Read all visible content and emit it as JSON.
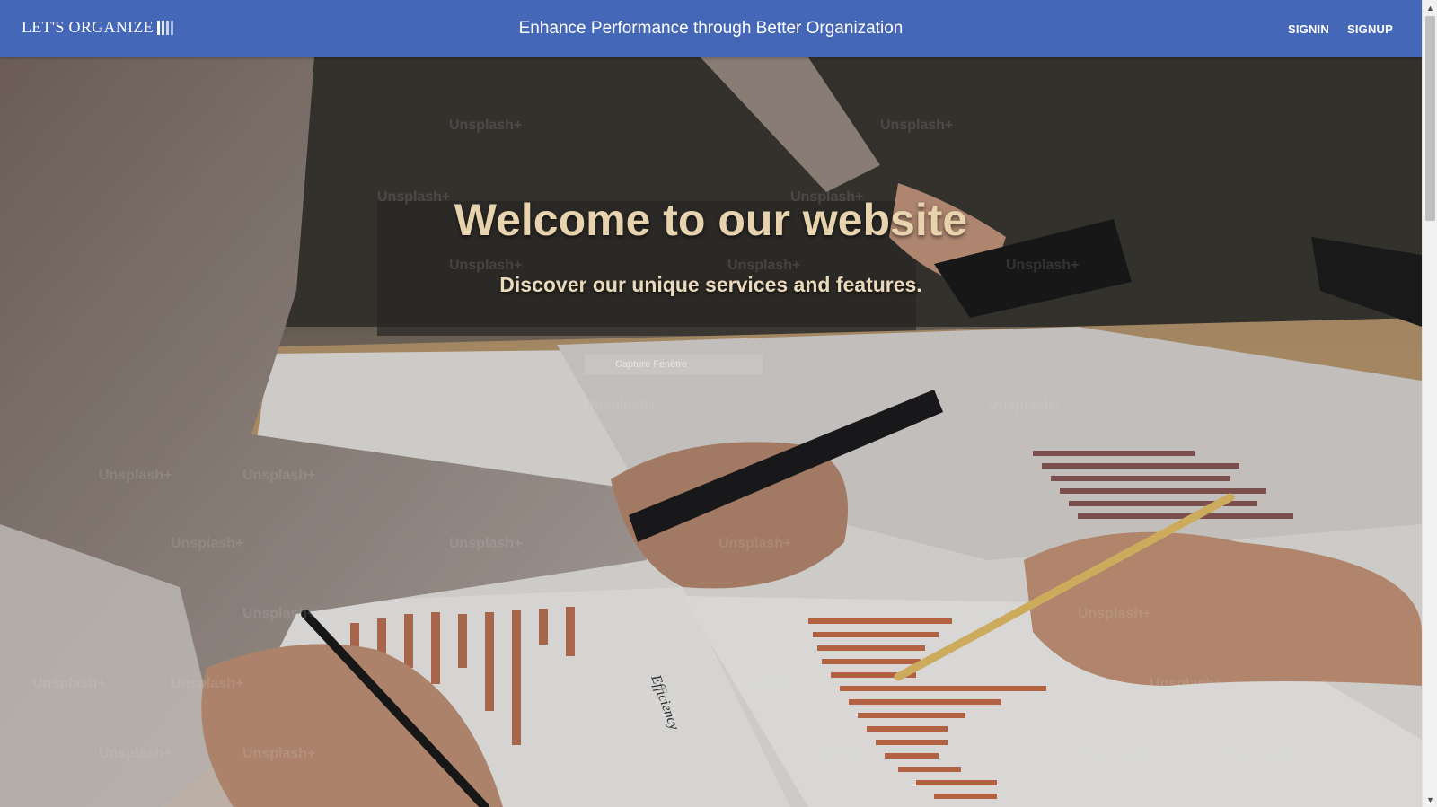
{
  "navbar": {
    "brand": "LET'S ORGANIZE",
    "title": "Enhance Performance through Better Organization",
    "signin": "SIGNIN",
    "signup": "SIGNUP",
    "background": "#4467b7"
  },
  "hero": {
    "title": "Welcome to our website",
    "subtitle": "Discover our unique services and features.",
    "title_color": "#e7d3ae",
    "chart_label": "Efficiency",
    "watermark": "Unsplash+"
  },
  "overlay": {
    "capture_label": "Capture Fenêtre"
  },
  "scrollbar": {
    "up_icon": "chevron-up-icon",
    "down_icon": "chevron-down-icon"
  }
}
